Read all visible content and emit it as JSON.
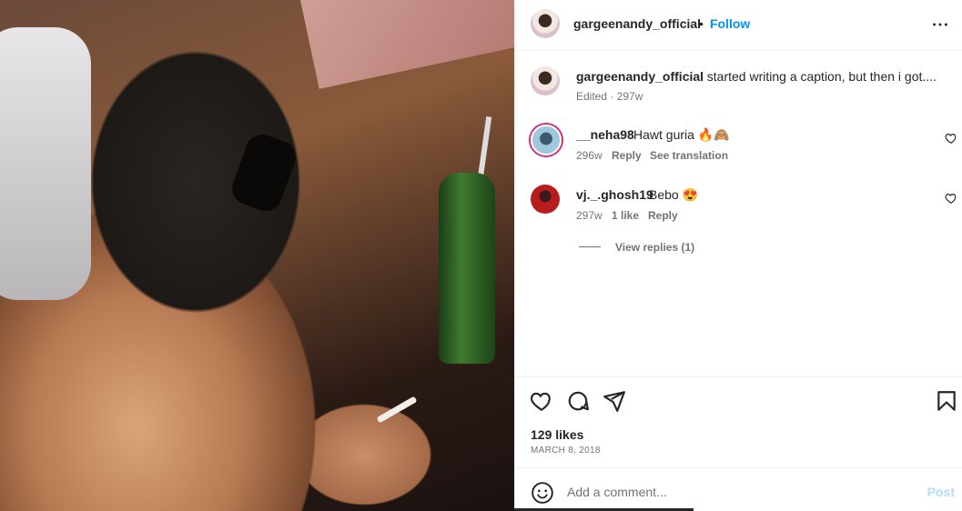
{
  "post": {
    "author": "gargeenandy_official",
    "follow_label": "Follow",
    "separator": "•",
    "caption": "I started writing a caption, but then i got....",
    "caption_meta": "Edited · 297w",
    "likes": "129 likes",
    "date": "MARCH 8, 2018"
  },
  "comments": [
    {
      "user": "__neha98",
      "text": "Hawt guria 🔥🙈",
      "time": "296w",
      "reply": "Reply",
      "see_translation": "See translation"
    },
    {
      "user": "vj._.ghosh19",
      "text": "Bebo 😍",
      "time": "297w",
      "likes": "1 like",
      "reply": "Reply"
    }
  ],
  "view_replies": "View replies (1)",
  "add_comment": {
    "placeholder": "Add a comment...",
    "post_label": "Post"
  },
  "icons": [
    "more-icon",
    "heart-icon",
    "comment-icon",
    "share-icon",
    "bookmark-icon",
    "emoji-icon"
  ],
  "colors": {
    "link": "#0095f6",
    "post_disabled": "#b2dffc",
    "text": "#262626",
    "muted": "#737373"
  }
}
